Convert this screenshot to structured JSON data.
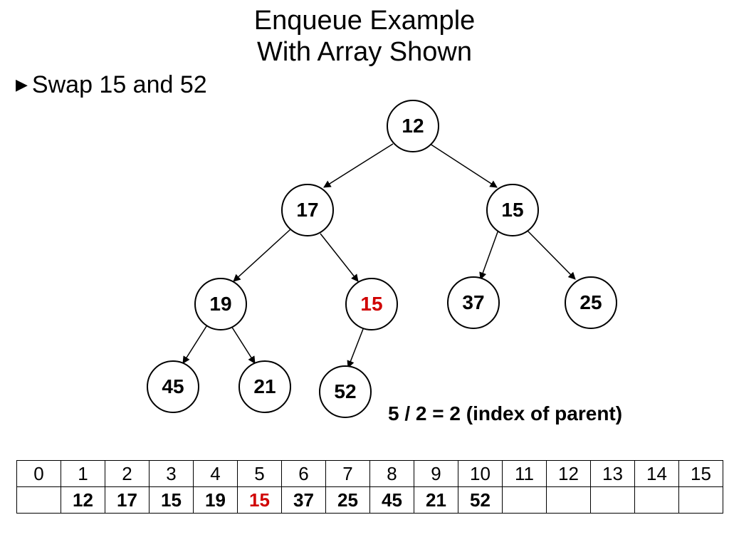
{
  "title_line1": "Enqueue Example",
  "title_line2": "With Array Shown",
  "bullet_text": "Swap 15 and 52",
  "annotation": "5 / 2 = 2 (index of parent)",
  "nodes": {
    "n1": "12",
    "n2": "17",
    "n3": "15",
    "n4": "19",
    "n5": "15",
    "n6": "37",
    "n7": "25",
    "n8": "45",
    "n9": "21",
    "n10": "52"
  },
  "highlight_node": "n5",
  "array": {
    "indices": [
      "0",
      "1",
      "2",
      "3",
      "4",
      "5",
      "6",
      "7",
      "8",
      "9",
      "10",
      "11",
      "12",
      "13",
      "14",
      "15"
    ],
    "values": [
      "",
      "12",
      "17",
      "15",
      "19",
      "15",
      "37",
      "25",
      "45",
      "21",
      "52",
      "",
      "",
      "",
      "",
      ""
    ],
    "highlight_value_col": 5
  },
  "chart_data": {
    "type": "tree",
    "description": "Binary min-heap shown as a tree with corresponding array representation",
    "nodes": [
      {
        "id": 1,
        "value": 12,
        "children": [
          2,
          3
        ]
      },
      {
        "id": 2,
        "value": 17,
        "children": [
          4,
          5
        ]
      },
      {
        "id": 3,
        "value": 15,
        "children": [
          6,
          7
        ]
      },
      {
        "id": 4,
        "value": 19,
        "children": [
          8,
          9
        ]
      },
      {
        "id": 5,
        "value": 15,
        "highlight": true,
        "children": [
          10
        ]
      },
      {
        "id": 6,
        "value": 37,
        "children": []
      },
      {
        "id": 7,
        "value": 25,
        "children": []
      },
      {
        "id": 8,
        "value": 45,
        "children": []
      },
      {
        "id": 9,
        "value": 21,
        "children": []
      },
      {
        "id": 10,
        "value": 52,
        "children": []
      }
    ],
    "array_indices": [
      0,
      1,
      2,
      3,
      4,
      5,
      6,
      7,
      8,
      9,
      10,
      11,
      12,
      13,
      14,
      15
    ],
    "array_values": [
      null,
      12,
      17,
      15,
      19,
      15,
      37,
      25,
      45,
      21,
      52,
      null,
      null,
      null,
      null,
      null
    ],
    "array_highlight_index": 5,
    "annotation": "5 / 2 = 2 (index of parent)"
  }
}
